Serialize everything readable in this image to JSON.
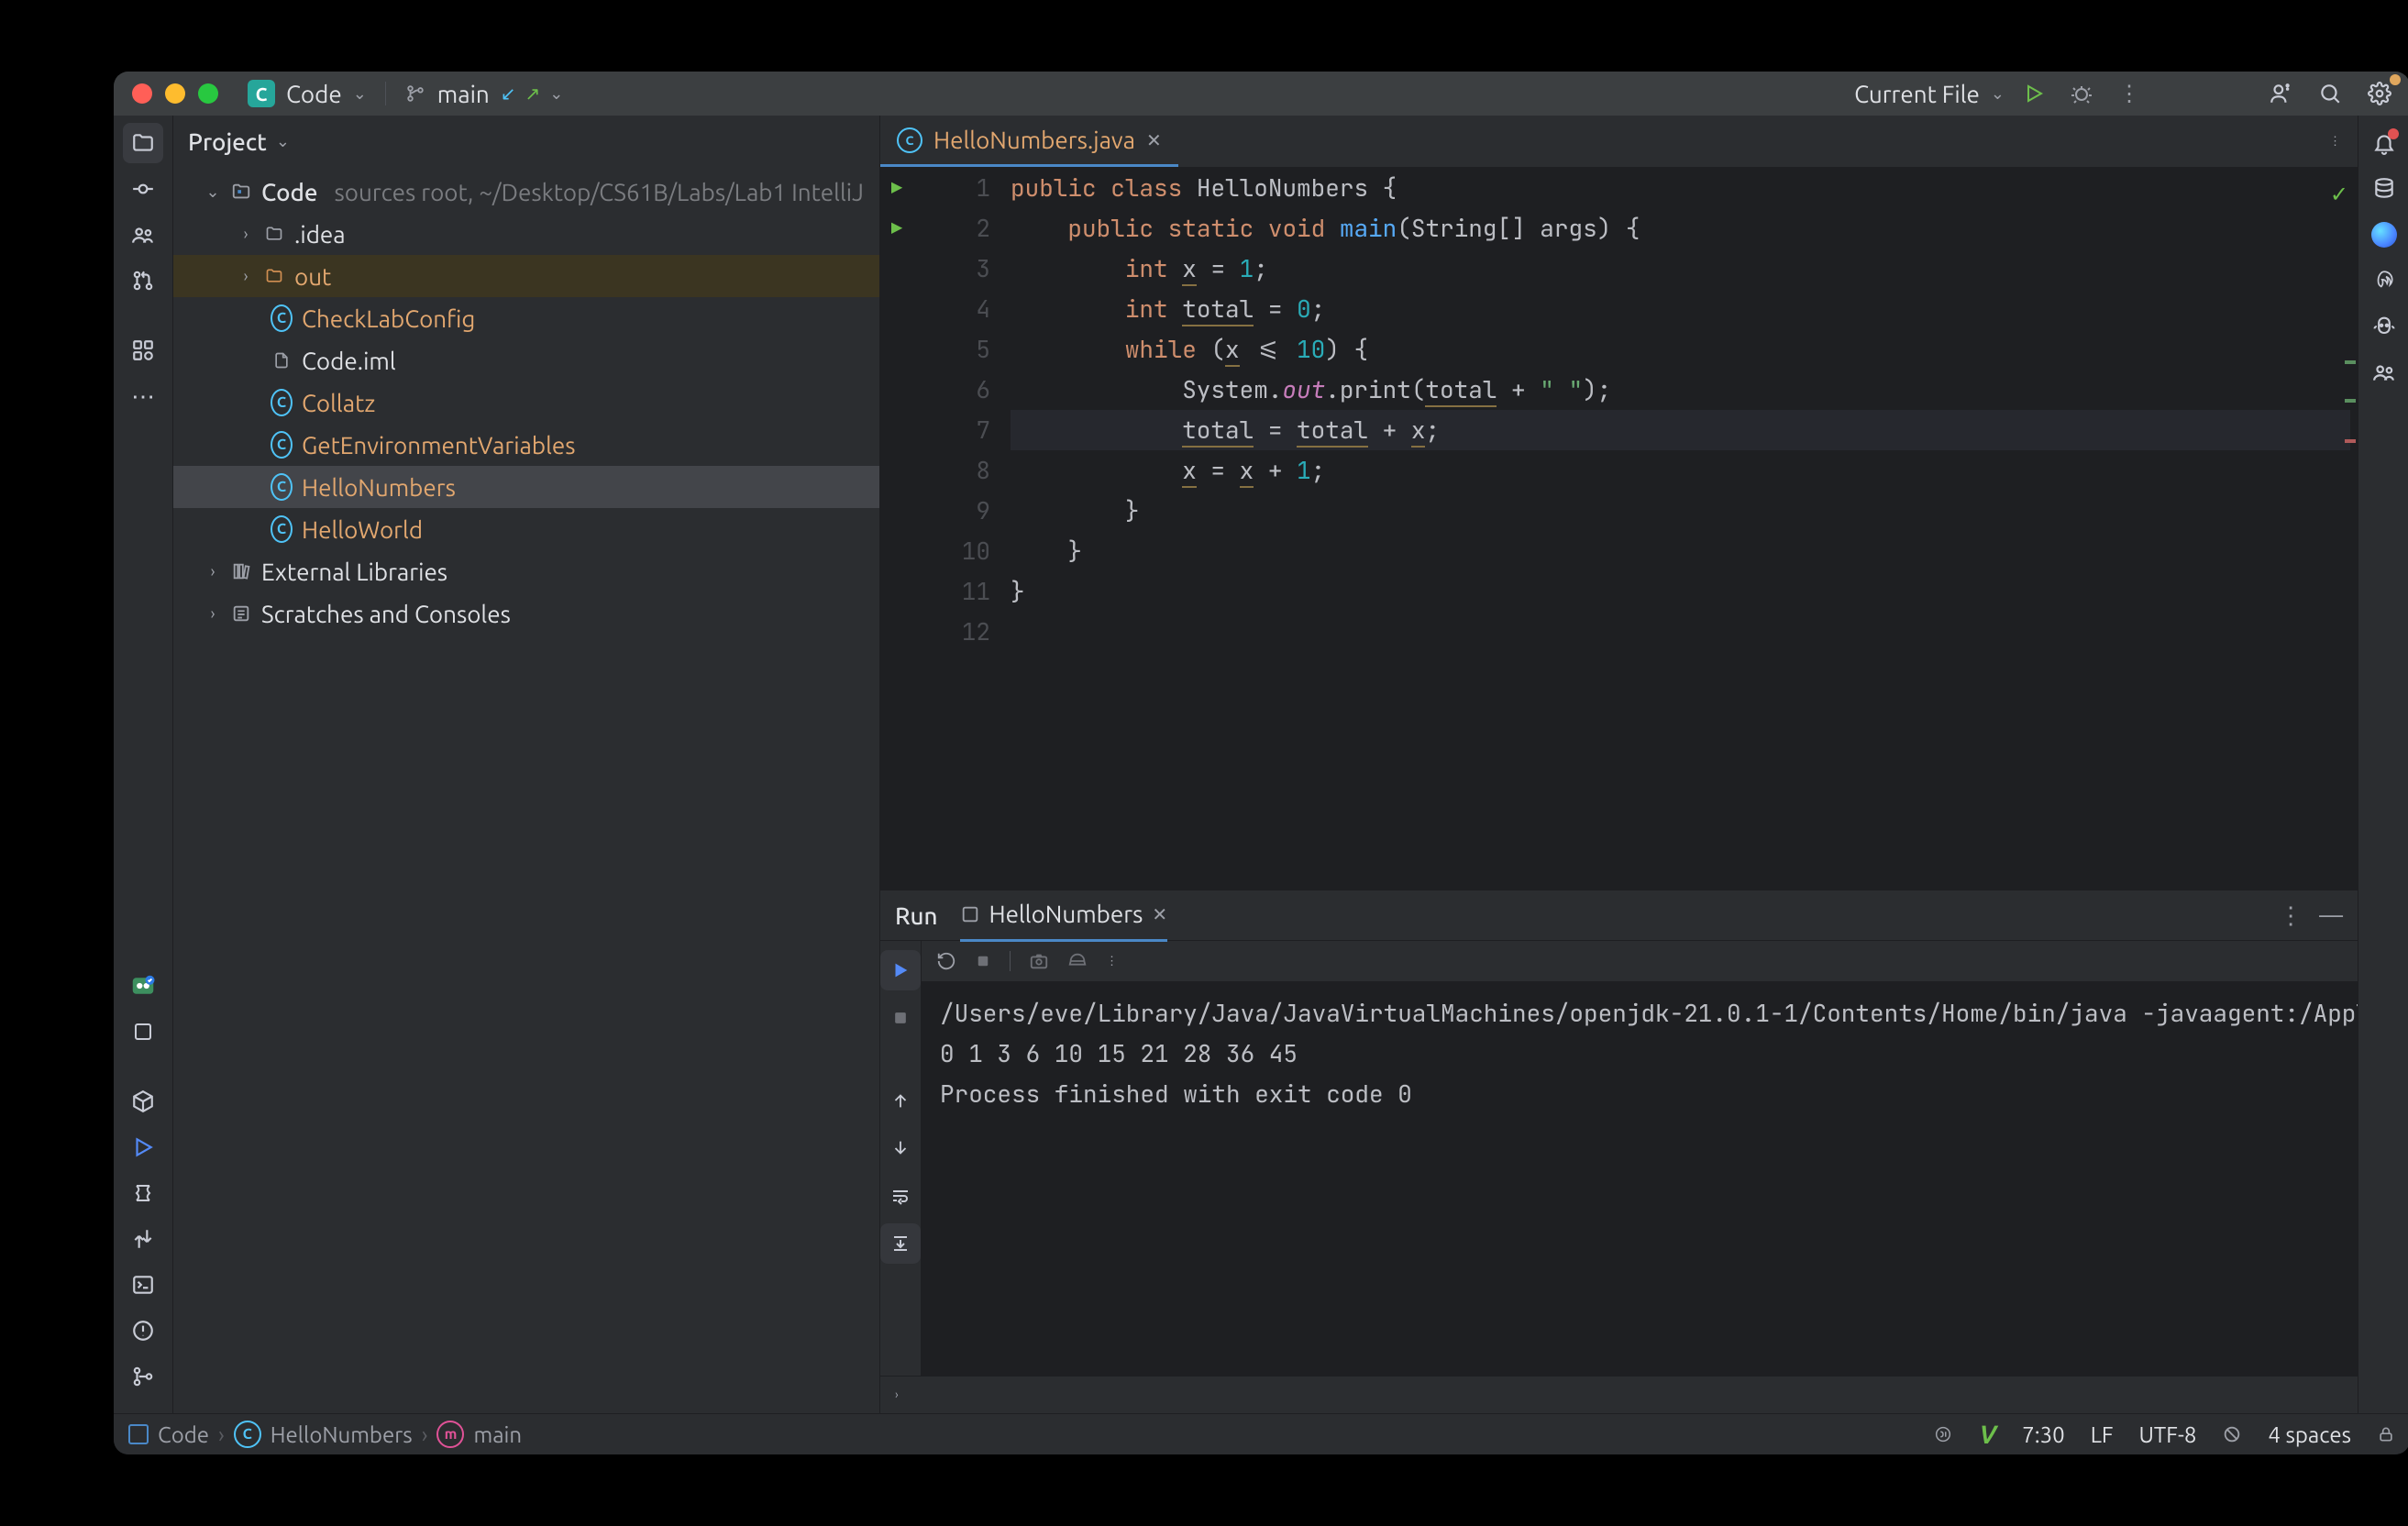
{
  "titlebar": {
    "project_chip": "C",
    "project_name": "Code",
    "branch": "main",
    "run_config": "Current File"
  },
  "sidebar": {
    "title": "Project",
    "root": {
      "name": "Code",
      "hint": "sources root,  ~/Desktop/CS61B/Labs/Lab1 IntelliJ"
    },
    "items": [
      {
        "name": ".idea",
        "kind": "folder",
        "orange": false
      },
      {
        "name": "out",
        "kind": "folder",
        "orange": true
      },
      {
        "name": "CheckLabConfig",
        "kind": "class",
        "orange": true
      },
      {
        "name": "Code.iml",
        "kind": "file"
      },
      {
        "name": "Collatz",
        "kind": "class",
        "orange": true
      },
      {
        "name": "GetEnvironmentVariables",
        "kind": "class",
        "orange": true
      },
      {
        "name": "HelloNumbers",
        "kind": "class",
        "orange": true,
        "selected": true
      },
      {
        "name": "HelloWorld",
        "kind": "class",
        "orange": true
      }
    ],
    "external": "External Libraries",
    "scratches": "Scratches and Consoles"
  },
  "editor": {
    "tab_name": "HelloNumbers.java",
    "lines": {
      "l1_kw_public": "public",
      "l1_kw_class": "class",
      "l1_name": "HelloNumbers",
      "l1_brace": " {",
      "l2_kw_public": "public",
      "l2_kw_static": "static",
      "l2_kw_void": "void",
      "l2_fn": "main",
      "l2_args": "(String[] args) {",
      "l3_kw_int": "int",
      "l3_var": "x",
      "l3_eq": " = ",
      "l3_val": "1",
      "l3_semi": ";",
      "l4_kw_int": "int",
      "l4_var": "total",
      "l4_eq": " = ",
      "l4_val": "0",
      "l4_semi": ";",
      "l5_kw_while": "while",
      "l5_open": " (",
      "l5_var": "x",
      "l5_op": " <= ",
      "l5_val": "10",
      "l5_close": ") {",
      "l6_sys": "System.",
      "l6_out": "out",
      "l6_print": ".print(",
      "l6_total": "total",
      "l6_plus": " + ",
      "l6_str": "\" \"",
      "l6_close": ");",
      "l7_total": "total",
      "l7_eq": " = ",
      "l7_total2": "total",
      "l7_plus": " + ",
      "l7_x": "x",
      "l7_semi": ";",
      "l8_x": "x",
      "l8_eq": " = ",
      "l8_x2": "x",
      "l8_plus": " + ",
      "l8_val": "1",
      "l8_semi": ";",
      "l9_close": "}",
      "l10_close": "}",
      "l11_close": "}"
    },
    "line_numbers": [
      "1",
      "2",
      "3",
      "4",
      "5",
      "6",
      "7",
      "8",
      "9",
      "10",
      "11",
      "12"
    ]
  },
  "run": {
    "title": "Run",
    "tab": "HelloNumbers",
    "console": {
      "cmd": "/Users/eve/Library/Java/JavaVirtualMachines/openjdk-21.0.1-1/Contents/Home/bin/java -javaagent:/Applications/IntelliJ IDEA.app/Contents/li",
      "out": "0 1 3 6 10 15 21 28 36 45 ",
      "exit": "Process finished with exit code 0"
    }
  },
  "status": {
    "crumb_project": "Code",
    "crumb_class": "HelloNumbers",
    "crumb_method": "main",
    "pos": "7:30",
    "eol": "LF",
    "enc": "UTF-8",
    "indent": "4 spaces"
  }
}
